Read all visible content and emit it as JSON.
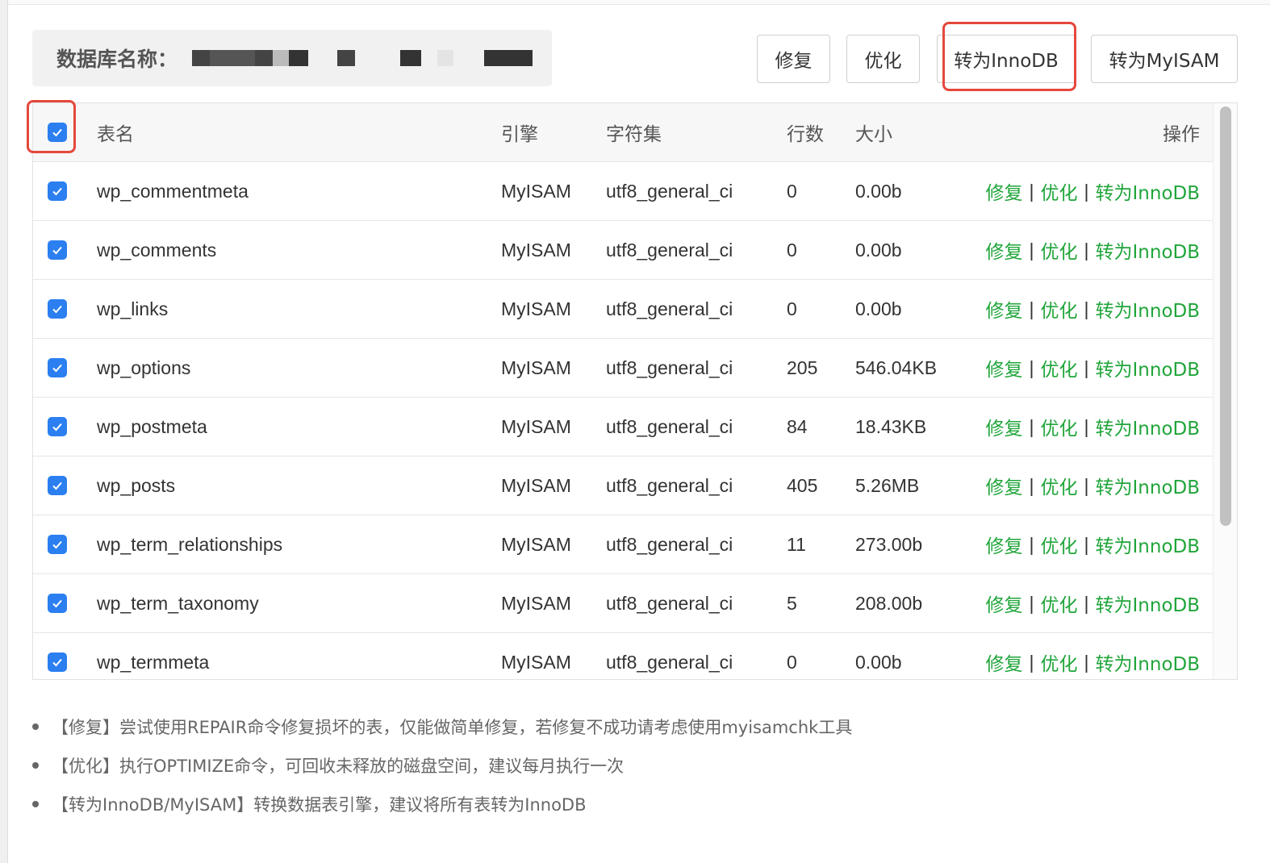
{
  "dialog": {
    "db_label": "数据库名称：",
    "buttons": {
      "repair": "修复",
      "optimize": "优化",
      "to_innodb": "转为InnoDB",
      "to_myisam": "转为MyISAM"
    }
  },
  "table": {
    "headers": {
      "name": "表名",
      "engine": "引擎",
      "charset": "字符集",
      "rows": "行数",
      "size": "大小",
      "ops": "操作"
    },
    "select_all_checked": true,
    "rows": [
      {
        "name": "wp_commentmeta",
        "engine": "MyISAM",
        "charset": "utf8_general_ci",
        "rows": "0",
        "size": "0.00b",
        "checked": true
      },
      {
        "name": "wp_comments",
        "engine": "MyISAM",
        "charset": "utf8_general_ci",
        "rows": "0",
        "size": "0.00b",
        "checked": true
      },
      {
        "name": "wp_links",
        "engine": "MyISAM",
        "charset": "utf8_general_ci",
        "rows": "0",
        "size": "0.00b",
        "checked": true
      },
      {
        "name": "wp_options",
        "engine": "MyISAM",
        "charset": "utf8_general_ci",
        "rows": "205",
        "size": "546.04KB",
        "checked": true
      },
      {
        "name": "wp_postmeta",
        "engine": "MyISAM",
        "charset": "utf8_general_ci",
        "rows": "84",
        "size": "18.43KB",
        "checked": true
      },
      {
        "name": "wp_posts",
        "engine": "MyISAM",
        "charset": "utf8_general_ci",
        "rows": "405",
        "size": "5.26MB",
        "checked": true
      },
      {
        "name": "wp_term_relationships",
        "engine": "MyISAM",
        "charset": "utf8_general_ci",
        "rows": "11",
        "size": "273.00b",
        "checked": true
      },
      {
        "name": "wp_term_taxonomy",
        "engine": "MyISAM",
        "charset": "utf8_general_ci",
        "rows": "5",
        "size": "208.00b",
        "checked": true
      },
      {
        "name": "wp_termmeta",
        "engine": "MyISAM",
        "charset": "utf8_general_ci",
        "rows": "0",
        "size": "0.00b",
        "checked": true
      }
    ],
    "row_ops": {
      "repair": "修复",
      "optimize": "优化",
      "to_innodb": "转为InnoDB",
      "separator": "|"
    }
  },
  "notes": [
    "【修复】尝试使用REPAIR命令修复损坏的表，仅能做简单修复，若修复不成功请考虑使用myisamchk工具",
    "【优化】执行OPTIMIZE命令，可回收未释放的磁盘空间，建议每月执行一次",
    "【转为InnoDB/MyISAM】转换数据表引擎，建议将所有表转为InnoDB"
  ],
  "colors": {
    "link_green": "#20a53a",
    "checkbox_blue": "#2b7ff0",
    "highlight_red": "#e5483b"
  }
}
